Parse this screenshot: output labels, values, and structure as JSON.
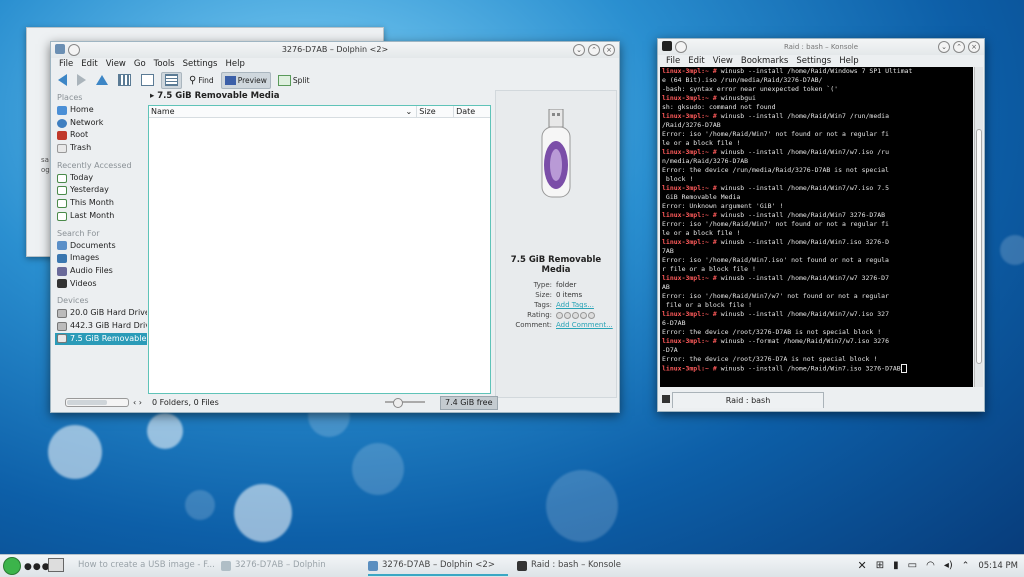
{
  "desktop": {
    "accent": "#2b9bb8"
  },
  "dolphin": {
    "title": "3276-D7AB – Dolphin <2>",
    "menu": [
      "File",
      "Edit",
      "View",
      "Go",
      "Tools",
      "Settings",
      "Help"
    ],
    "toolbar": {
      "find": "Find",
      "preview": "Preview",
      "split": "Split"
    },
    "sidebar": {
      "places_header": "Places",
      "places": [
        "Home",
        "Network",
        "Root",
        "Trash"
      ],
      "recent_header": "Recently Accessed",
      "recent": [
        "Today",
        "Yesterday",
        "This Month",
        "Last Month"
      ],
      "search_header": "Search For",
      "search": [
        "Documents",
        "Images",
        "Audio Files",
        "Videos"
      ],
      "devices_header": "Devices",
      "devices": [
        "20.0 GiB Hard Drive",
        "442.3 GiB Hard Drive",
        "7.5 GiB Removable Media"
      ]
    },
    "breadcrumb": "7.5 GiB Removable Media",
    "columns": {
      "name": "Name",
      "size": "Size",
      "date": "Date"
    },
    "preview": {
      "title": "7.5 GiB Removable Media",
      "type_label": "Type:",
      "type_value": "folder",
      "size_label": "Size:",
      "size_value": "0 items",
      "tags_label": "Tags:",
      "tags_value": "Add Tags...",
      "rating_label": "Rating:",
      "comment_label": "Comment:",
      "comment_value": "Add Comment..."
    },
    "status": {
      "counts": "0 Folders, 0 Files",
      "free": "7.4 GiB free"
    }
  },
  "konsole": {
    "title": "Raid : bash – Konsole",
    "menu": [
      "File",
      "Edit",
      "View",
      "Bookmarks",
      "Settings",
      "Help"
    ],
    "prompt": "linux-3mpl:~ #",
    "lines": [
      {
        "p": true,
        "t": " winusb --install /home/Raid/Windows 7 SP1 Ultimat"
      },
      {
        "p": false,
        "t": "e (64 Bit).iso /run/media/Raid/3276-D7AB/"
      },
      {
        "p": false,
        "t": "-bash: syntax error near unexpected token `('"
      },
      {
        "p": true,
        "t": " winusbgui"
      },
      {
        "p": false,
        "t": "sh: gksudo: command not found"
      },
      {
        "p": true,
        "t": " winusb --install /home/Raid/Win7 /run/media"
      },
      {
        "p": false,
        "t": "/Raid/3276-D7AB"
      },
      {
        "p": false,
        "t": "Error: iso '/home/Raid/Win7' not found or not a regular fi"
      },
      {
        "p": false,
        "t": "le or a block file !"
      },
      {
        "p": true,
        "t": " winusb --install /home/Raid/Win7/w7.iso /ru"
      },
      {
        "p": false,
        "t": "n/media/Raid/3276-D7AB"
      },
      {
        "p": false,
        "t": "Error: the device /run/media/Raid/3276-D7AB is not special"
      },
      {
        "p": false,
        "t": " block !"
      },
      {
        "p": true,
        "t": " winusb --install /home/Raid/Win7/w7.iso 7.5"
      },
      {
        "p": false,
        "t": " GiB Removable Media"
      },
      {
        "p": false,
        "t": "Error: Unknown argument 'GiB' !"
      },
      {
        "p": true,
        "t": " winusb --install /home/Raid/Win7 3276-D7AB"
      },
      {
        "p": false,
        "t": "Error: iso '/home/Raid/Win7' not found or not a regular fi"
      },
      {
        "p": false,
        "t": "le or a block file !"
      },
      {
        "p": true,
        "t": " winusb --install /home/Raid/Win7.iso 3276-D"
      },
      {
        "p": false,
        "t": "7AB"
      },
      {
        "p": false,
        "t": "Error: iso '/home/Raid/Win7.iso' not found or not a regula"
      },
      {
        "p": false,
        "t": "r file or a block file !"
      },
      {
        "p": true,
        "t": " winusb --install /home/Raid/Win7/w7 3276-D7"
      },
      {
        "p": false,
        "t": "AB"
      },
      {
        "p": false,
        "t": "Error: iso '/home/Raid/Win7/w7' not found or not a regular"
      },
      {
        "p": false,
        "t": " file or a block file !"
      },
      {
        "p": true,
        "t": " winusb --install /home/Raid/Win7/w7.iso 327"
      },
      {
        "p": false,
        "t": "6-D7AB"
      },
      {
        "p": false,
        "t": "Error: the device /root/3276-D7AB is not special block !"
      },
      {
        "p": true,
        "t": " winusb --format /home/Raid/Win7/w7.iso 3276"
      },
      {
        "p": false,
        "t": "-D7A"
      },
      {
        "p": false,
        "t": "Error: the device /root/3276-D7A is not special block !"
      },
      {
        "p": true,
        "t": " winusb --install /home/Raid/Win7.iso 3276-D7AB"
      }
    ],
    "tab": "Raid : bash"
  },
  "taskbar": {
    "tasks": [
      "How to create a USB image - F...",
      "3276-D7AB – Dolphin",
      "3276-D7AB – Dolphin <2>",
      "Raid : bash – Konsole"
    ],
    "clock": "05:14 PM"
  },
  "bgwindow": {
    "text": "sa\nog"
  }
}
